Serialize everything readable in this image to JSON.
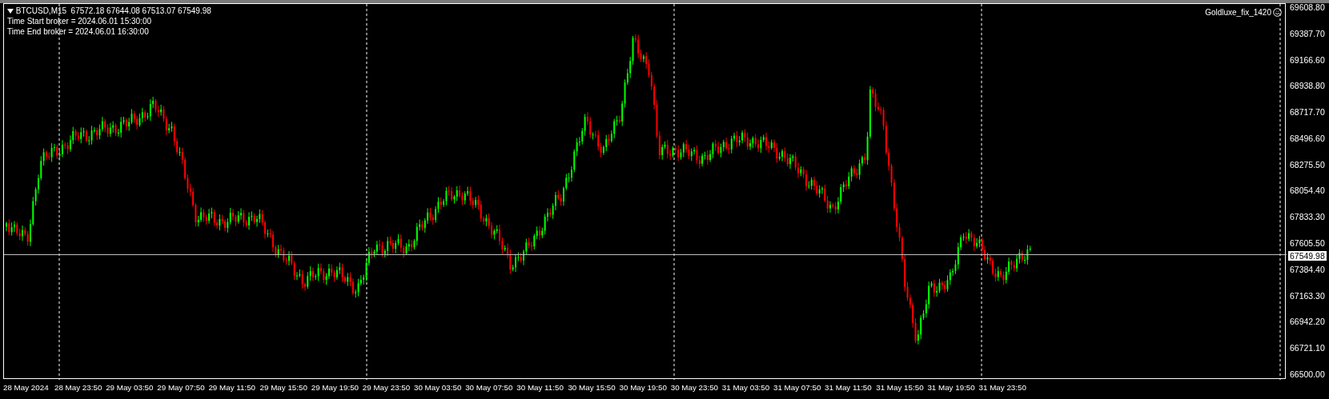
{
  "symbol_header": {
    "symbol": "BTCUSD,M15",
    "ohlc": "67572.18 67644.08 67513.07 67549.98"
  },
  "info_lines": [
    "Time Start broker = 2024.06.01 15:30:00",
    "Time End broker = 2024.06.01 16:30:00"
  ],
  "expert": {
    "name": "Goldluxe_fix_1420"
  },
  "price_axis": {
    "labels": [
      "69608.80",
      "69387.70",
      "69166.60",
      "68938.80",
      "68717.70",
      "68496.60",
      "68275.50",
      "68054.40",
      "67833.30",
      "67605.50",
      "67384.40",
      "67163.30",
      "66942.20",
      "66721.10",
      "66500.00"
    ],
    "current_price": "67549.98"
  },
  "time_axis": {
    "labels": [
      "28 May 2024",
      "28 May 23:50",
      "29 May 03:50",
      "29 May 07:50",
      "29 May 11:50",
      "29 May 15:50",
      "29 May 19:50",
      "29 May 23:50",
      "30 May 03:50",
      "30 May 07:50",
      "30 May 11:50",
      "30 May 15:50",
      "30 May 19:50",
      "30 May 23:50",
      "31 May 03:50",
      "31 May 07:50",
      "31 May 11:50",
      "31 May 15:50",
      "31 May 19:50",
      "31 May 23:50"
    ]
  }
}
